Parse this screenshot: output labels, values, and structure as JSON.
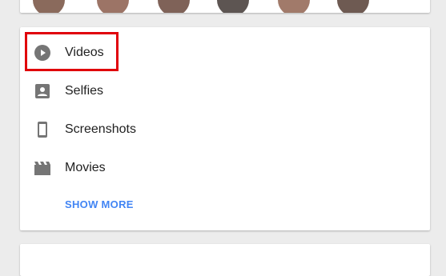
{
  "top_card": {
    "avatars": [
      {
        "name": "person-avatar-1",
        "color": "#8a6a5c"
      },
      {
        "name": "person-avatar-2",
        "color": "#9c7466"
      },
      {
        "name": "person-avatar-3",
        "color": "#7f6258"
      },
      {
        "name": "person-avatar-4",
        "color": "#5d5552"
      },
      {
        "name": "person-avatar-5",
        "color": "#a17a6a"
      },
      {
        "name": "person-avatar-6",
        "color": "#6e5a52"
      }
    ]
  },
  "categories": {
    "items": [
      {
        "label": "Videos",
        "icon": "play-circle-icon"
      },
      {
        "label": "Selfies",
        "icon": "account-box-icon"
      },
      {
        "label": "Screenshots",
        "icon": "smartphone-icon"
      },
      {
        "label": "Movies",
        "icon": "movie-clapper-icon"
      }
    ],
    "show_more_label": "SHOW MORE"
  },
  "colors": {
    "icon": "#757575",
    "accent": "#4285f4",
    "highlight": "#e0000b"
  }
}
